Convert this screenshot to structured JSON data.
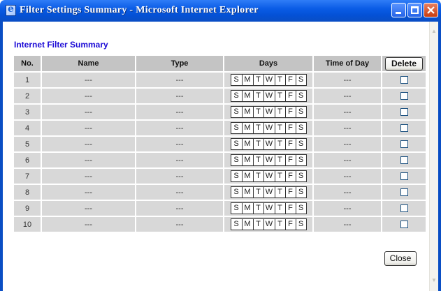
{
  "window": {
    "title": "Filter Settings Summary - Microsoft Internet Explorer",
    "icon": "ie-page-icon",
    "controls": [
      "minimize-icon",
      "maximize-icon",
      "close-icon"
    ]
  },
  "page": {
    "heading": "Internet Filter Summary",
    "columns": {
      "no": "No.",
      "name": "Name",
      "type": "Type",
      "days": "Days",
      "time_of_day": "Time of Day",
      "delete_button": "Delete"
    },
    "day_letters": [
      "S",
      "M",
      "T",
      "W",
      "T",
      "F",
      "S"
    ],
    "rows": [
      {
        "no": "1",
        "name": "---",
        "type": "---",
        "time": "---",
        "checked": false
      },
      {
        "no": "2",
        "name": "---",
        "type": "---",
        "time": "---",
        "checked": false
      },
      {
        "no": "3",
        "name": "---",
        "type": "---",
        "time": "---",
        "checked": false
      },
      {
        "no": "4",
        "name": "---",
        "type": "---",
        "time": "---",
        "checked": false
      },
      {
        "no": "5",
        "name": "---",
        "type": "---",
        "time": "---",
        "checked": false
      },
      {
        "no": "6",
        "name": "---",
        "type": "---",
        "time": "---",
        "checked": false
      },
      {
        "no": "7",
        "name": "---",
        "type": "---",
        "time": "---",
        "checked": false
      },
      {
        "no": "8",
        "name": "---",
        "type": "---",
        "time": "---",
        "checked": false
      },
      {
        "no": "9",
        "name": "---",
        "type": "---",
        "time": "---",
        "checked": false
      },
      {
        "no": "10",
        "name": "---",
        "type": "---",
        "time": "---",
        "checked": false
      }
    ],
    "close_button": "Close"
  },
  "colors": {
    "title_bar": "#0a5ce6",
    "heading": "#1c0bd6",
    "header_cell": "#c4c4c4",
    "body_cell": "#d8d8d8"
  }
}
